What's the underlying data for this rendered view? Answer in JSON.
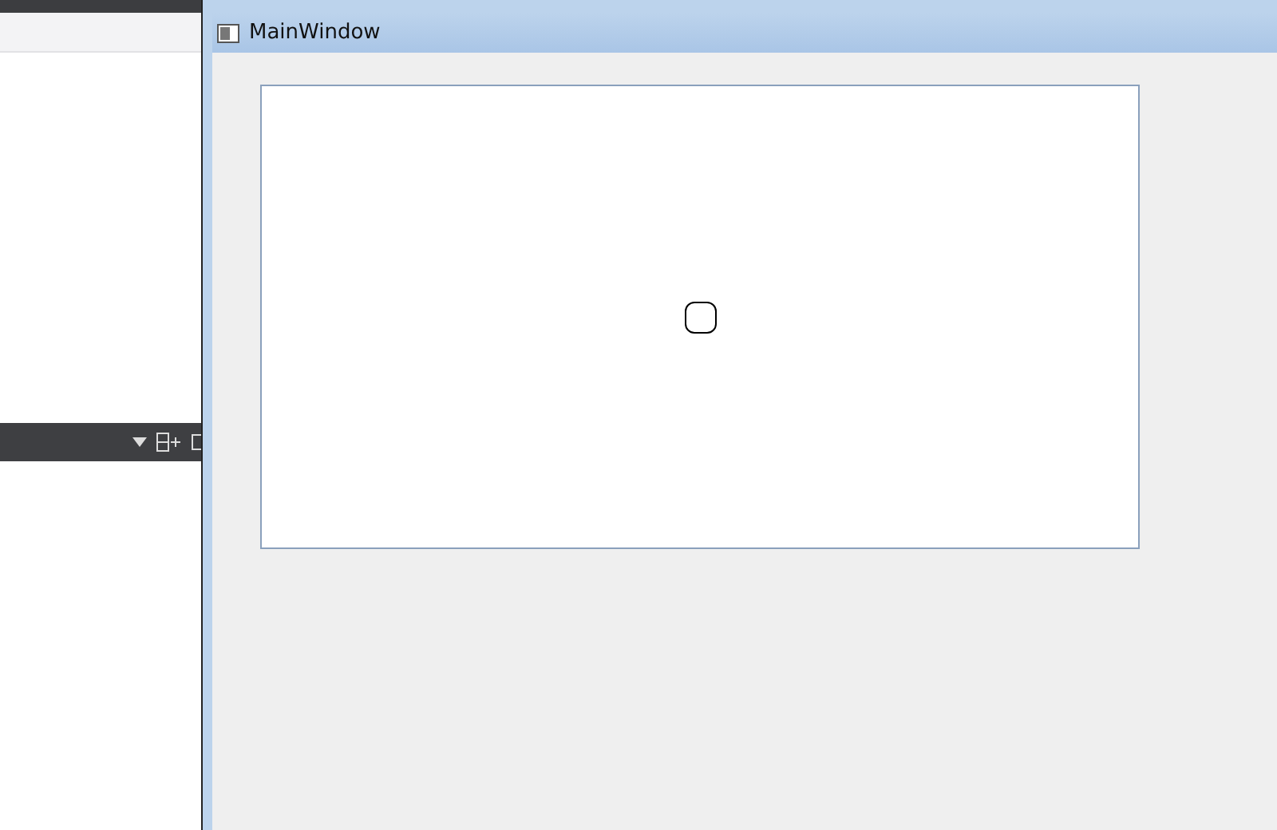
{
  "window": {
    "title": "MainWindow"
  }
}
